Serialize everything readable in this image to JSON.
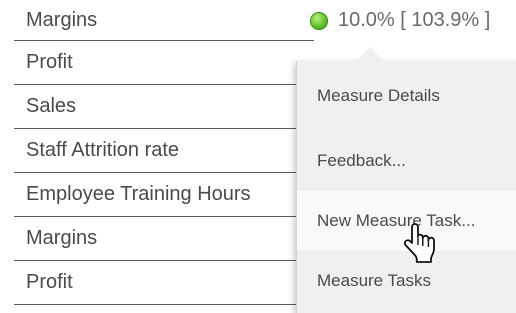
{
  "rows": [
    {
      "label": "Margins"
    },
    {
      "label": "Profit"
    },
    {
      "label": "Sales"
    },
    {
      "label": "Staff Attrition rate"
    },
    {
      "label": "Employee Training Hours"
    },
    {
      "label": "Margins"
    },
    {
      "label": "Profit"
    }
  ],
  "status": {
    "value_text": "10.0% [ 103.9% ]",
    "indicator_color": "#5bbf2a"
  },
  "context_menu": {
    "items": [
      {
        "label": "Measure Details"
      },
      {
        "label": "Feedback..."
      },
      {
        "label": "New Measure Task..."
      },
      {
        "label": "Measure Tasks"
      }
    ],
    "hovered_item": "New Measure Task..."
  },
  "cursor": {
    "type": "hand-pointer"
  }
}
